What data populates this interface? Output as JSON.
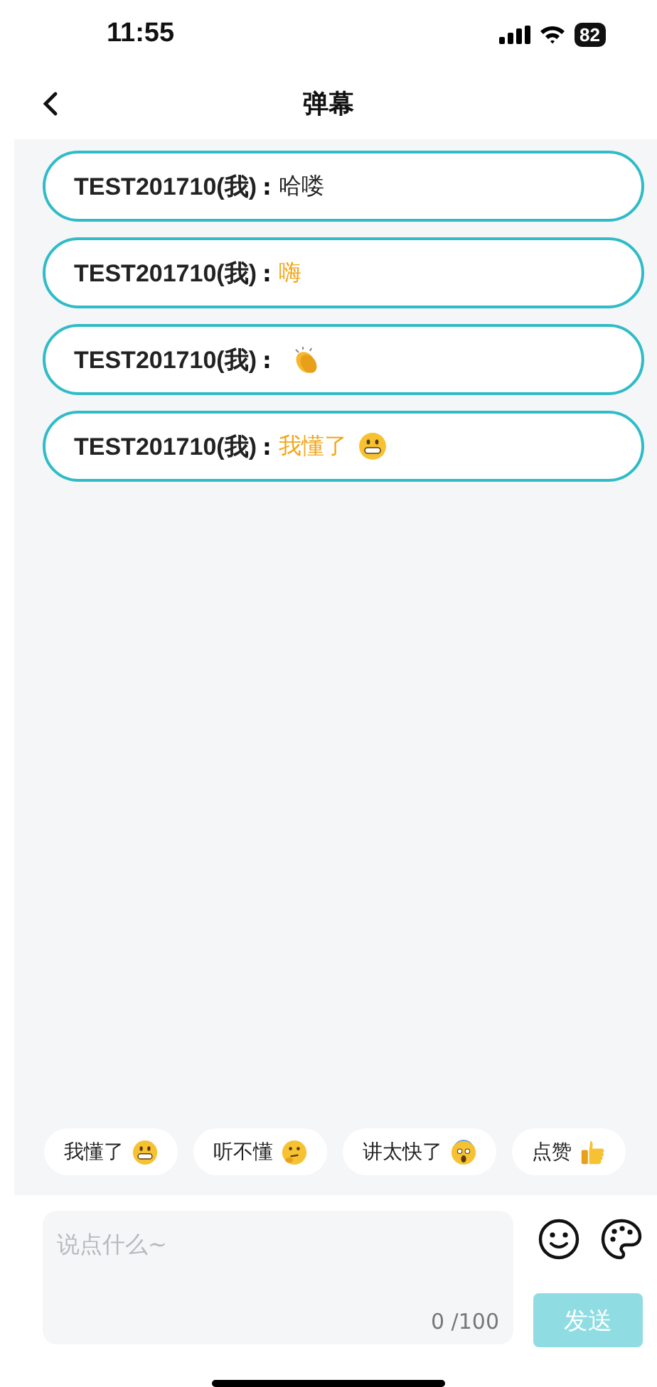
{
  "status_bar": {
    "time": "11:55",
    "battery": "82"
  },
  "nav": {
    "title": "弹幕"
  },
  "messages": [
    {
      "sender": "TEST201710(我)",
      "separator": ":",
      "text": "哈喽",
      "highlighted": false,
      "kind": "plain"
    },
    {
      "sender": "TEST201710(我)",
      "separator": ":",
      "text": "嗨",
      "highlighted": true,
      "kind": "plain"
    },
    {
      "sender": "TEST201710(我)",
      "separator": ":",
      "kind": "clap"
    },
    {
      "sender": "TEST201710(我)",
      "separator": ":",
      "text": "我懂了",
      "highlighted": true,
      "kind": "grin"
    }
  ],
  "quick_replies": [
    {
      "label": "我懂了",
      "kind": "grin"
    },
    {
      "label": "听不懂",
      "kind": "think"
    },
    {
      "label": "讲太快了",
      "kind": "scream"
    },
    {
      "label": "点赞",
      "kind": "thumbs"
    }
  ],
  "composer": {
    "placeholder": "说点什么~",
    "counter": "0 /100",
    "send": "发送",
    "send_disabled": true
  }
}
